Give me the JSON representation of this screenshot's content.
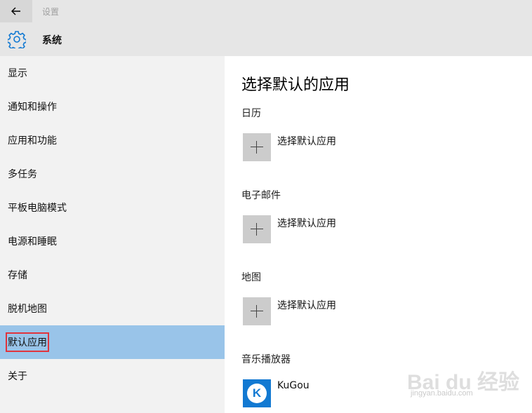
{
  "window": {
    "title": "设置"
  },
  "header": {
    "section_title": "系统"
  },
  "sidebar": {
    "items": [
      {
        "label": "显示"
      },
      {
        "label": "通知和操作"
      },
      {
        "label": "应用和功能"
      },
      {
        "label": "多任务"
      },
      {
        "label": "平板电脑模式"
      },
      {
        "label": "电源和睡眠"
      },
      {
        "label": "存储"
      },
      {
        "label": "脱机地图"
      },
      {
        "label": "默认应用"
      },
      {
        "label": "关于"
      }
    ],
    "selected": "默认应用"
  },
  "main": {
    "title": "选择默认的应用",
    "categories": [
      {
        "label": "日历",
        "app": "选择默认应用"
      },
      {
        "label": "电子邮件",
        "app": "选择默认应用"
      },
      {
        "label": "地图",
        "app": "选择默认应用"
      },
      {
        "label": "音乐播放器",
        "app": "KuGou",
        "app_icon_letter": "K"
      }
    ]
  },
  "watermark": {
    "text": "Bai du 经验",
    "sub": "jingyan.baidu.com"
  },
  "colors": {
    "accent": "#1279d2",
    "selected_bg": "#99c4e9",
    "highlight_box": "#e0343d",
    "topbar_bg": "#e6e6e6",
    "sidebar_bg": "#f2f2f2"
  }
}
